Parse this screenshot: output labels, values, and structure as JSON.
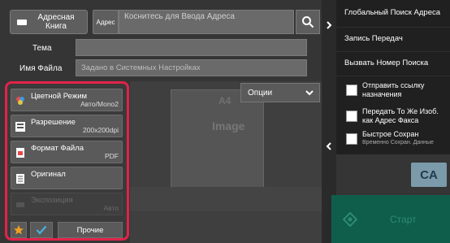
{
  "top": {
    "address_book_label": "Адресная Книга",
    "address_tag": "Адрес",
    "address_placeholder": "Коснитесь для Ввода Адреса"
  },
  "fields": {
    "subject_label": "Тема",
    "subject_value": "",
    "filename_label": "Имя Файла",
    "filename_placeholder": "Задано в Системных Настройках"
  },
  "preview": {
    "paper_size": "A4",
    "image_text": "Image",
    "options_label": "Опции"
  },
  "settings_panel": {
    "items": [
      {
        "label": "Цветной Режим",
        "value": "Авто/Mono2",
        "icon": "color-mode-icon",
        "enabled": true
      },
      {
        "label": "Разрешение",
        "value": "200x200dpi",
        "icon": "resolution-icon",
        "enabled": true
      },
      {
        "label": "Формат Файла",
        "value": "PDF",
        "icon": "file-format-icon",
        "enabled": true
      },
      {
        "label": "Оригинал",
        "value": "",
        "icon": "original-icon",
        "enabled": true
      },
      {
        "label": "Экспозиция",
        "value": "Авто",
        "icon": "exposure-icon",
        "enabled": false
      }
    ],
    "other_label": "Прочие"
  },
  "right_panel": {
    "global_search": "Глобальный Поиск Адреса",
    "send_log": "Запись Передач",
    "call_number": "Вызвать Номер Поиска",
    "checks": [
      {
        "label": "Отправить ссылку назначения",
        "sub": ""
      },
      {
        "label": "Передать То Же Изоб. как Адрес Факса",
        "sub": ""
      },
      {
        "label": "Быстрое Сохран",
        "sub": "Временно Сохран. Данные"
      }
    ],
    "ca_label": "CA",
    "start_label": "Старт"
  },
  "colors": {
    "highlight_border": "#e0234a",
    "start_bg": "#0f5e4c",
    "ca_bg": "#7c9baa",
    "star": "#f0a020",
    "check": "#4ab0e0"
  }
}
